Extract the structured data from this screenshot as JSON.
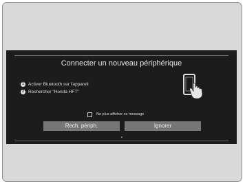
{
  "dialog": {
    "title": "Connecter un nouveau périphérique",
    "steps": [
      {
        "number": "1",
        "text": "Activer Bluetooth sur l'appareil"
      },
      {
        "number": "2",
        "text": "Rechercher \"Honda HFT\""
      }
    ],
    "checkbox_label": "Ne plus afficher ce message",
    "checkbox_checked": false,
    "buttons": {
      "scan": "Rech. périph.",
      "ignore": "Ignorer"
    },
    "illustration_icon": "phone-with-hand-icon"
  },
  "colors": {
    "screen_background": "#1c1c1c",
    "button_background": "#777777",
    "frame_background": "#d9d9d9"
  }
}
